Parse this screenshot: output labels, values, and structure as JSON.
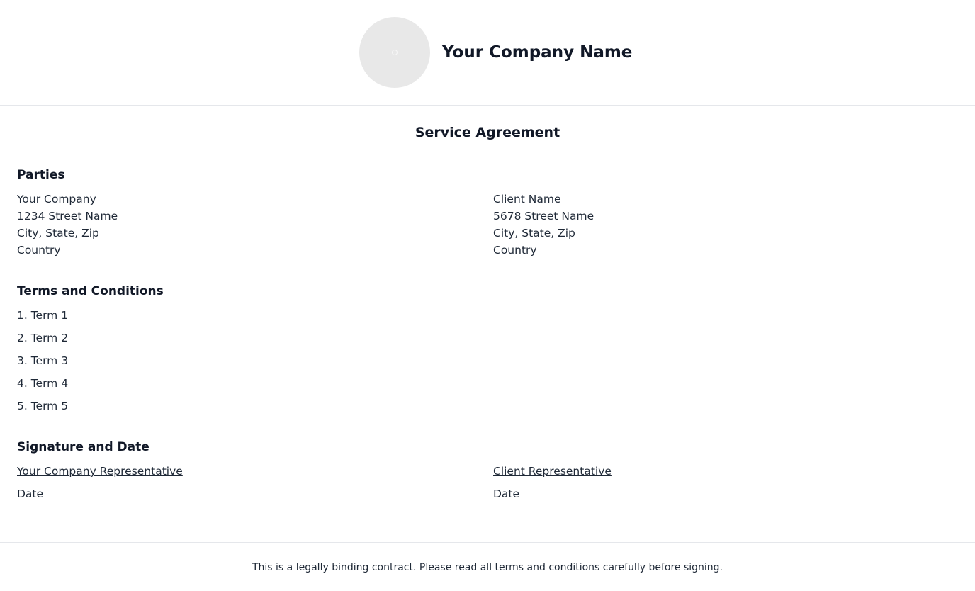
{
  "header": {
    "company_name": "Your Company Name",
    "logo_icon": "logo-placeholder-icon"
  },
  "document": {
    "title": "Service Agreement"
  },
  "parties": {
    "heading": "Parties",
    "company": {
      "name": "Your Company",
      "street": "1234 Street Name",
      "city": "City, State, Zip",
      "country": "Country"
    },
    "client": {
      "name": "Client Name",
      "street": "5678 Street Name",
      "city": "City, State, Zip",
      "country": "Country"
    }
  },
  "terms": {
    "heading": "Terms and Conditions",
    "items": [
      "1. Term 1",
      "2. Term 2",
      "3. Term 3",
      "4. Term 4",
      "5. Term 5"
    ]
  },
  "signature": {
    "heading": "Signature and Date",
    "company_rep": "Your Company Representative",
    "client_rep": "Client Representative",
    "company_date": "Date",
    "client_date": "Date"
  },
  "footer": {
    "text": "This is a legally binding contract. Please read all terms and conditions carefully before signing."
  },
  "colors": {
    "heading": "#111827",
    "body_text": "#1f2937",
    "divider": "#e5e7eb",
    "logo_bg": "#e8e8e8"
  }
}
